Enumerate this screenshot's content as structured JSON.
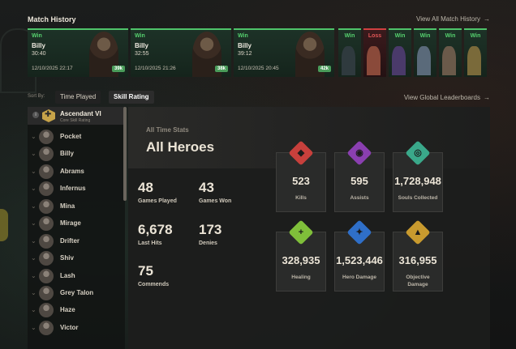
{
  "header": {
    "title": "Match History",
    "view_all": "View All Match History",
    "arrow": "→"
  },
  "matches": [
    {
      "result": "Win",
      "name": "Billy",
      "duration": "30:40",
      "date": "12/10/2025 22:17",
      "score": "39k"
    },
    {
      "result": "Win",
      "name": "Billy",
      "duration": "32:55",
      "date": "12/10/2025 21:26",
      "score": "38k"
    },
    {
      "result": "Win",
      "name": "Billy",
      "duration": "39:12",
      "date": "12/10/2025 20:45",
      "score": "42k"
    }
  ],
  "small_matches": [
    {
      "result": "Win"
    },
    {
      "result": "Loss"
    },
    {
      "result": "Win"
    },
    {
      "result": "Win"
    },
    {
      "result": "Win"
    },
    {
      "result": "Win"
    }
  ],
  "sort": {
    "label": "Sort By:",
    "time_played": "Time Played",
    "skill_rating": "Skill Rating",
    "leaderboards": "View Global Leaderboards"
  },
  "rank": {
    "info": "i",
    "name": "Ascendant VI",
    "sub": "Core Skill Rating"
  },
  "heroes": [
    "Pocket",
    "Billy",
    "Abrams",
    "Infernus",
    "Mina",
    "Mirage",
    "Drifter",
    "Shiv",
    "Lash",
    "Grey Talon",
    "Haze",
    "Victor"
  ],
  "stats": {
    "section": "All Time Stats",
    "title": "All Heroes",
    "games_played": {
      "value": "48",
      "label": "Games Played"
    },
    "games_won": {
      "value": "43",
      "label": "Games Won"
    },
    "last_hits": {
      "value": "6,678",
      "label": "Last Hits"
    },
    "denies": {
      "value": "173",
      "label": "Denies"
    },
    "commends": {
      "value": "75",
      "label": "Commends"
    }
  },
  "tiles": [
    {
      "value": "523",
      "label": "Kills",
      "color": "#c7403c",
      "icon": "kills-icon"
    },
    {
      "value": "595",
      "label": "Assists",
      "color": "#8a3fb0",
      "icon": "assists-icon"
    },
    {
      "value": "1,728,948",
      "label": "Souls Collected",
      "color": "#3aa88a",
      "icon": "souls-icon"
    },
    {
      "value": "328,935",
      "label": "Healing",
      "color": "#7fbf3a",
      "icon": "healing-icon"
    },
    {
      "value": "1,523,446",
      "label": "Hero Damage",
      "color": "#2f6fc8",
      "icon": "hero-damage-icon"
    },
    {
      "value": "316,955",
      "label": "Objective Damage",
      "color": "#c89a2e",
      "icon": "objective-damage-icon"
    }
  ]
}
